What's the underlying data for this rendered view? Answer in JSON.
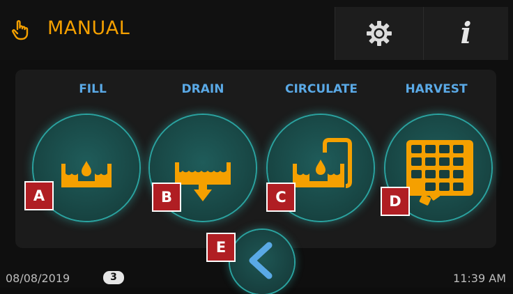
{
  "header": {
    "mode_title": "MANUAL",
    "mode_icon": "hand-pointer-icon",
    "settings_icon": "gear-icon",
    "info_icon": "info-icon",
    "info_glyph": "i"
  },
  "actions": [
    {
      "label": "FILL",
      "icon": "fill-tank-icon",
      "marker": "A"
    },
    {
      "label": "DRAIN",
      "icon": "drain-tank-icon",
      "marker": "B"
    },
    {
      "label": "CIRCULATE",
      "icon": "circulate-icon",
      "marker": "C"
    },
    {
      "label": "HARVEST",
      "icon": "harvest-icon",
      "marker": "D"
    }
  ],
  "back": {
    "icon": "chevron-left-icon",
    "marker": "E"
  },
  "footer": {
    "date": "08/08/2019",
    "badge": "3",
    "time": "11:39 AM"
  },
  "colors": {
    "accent_orange": "#f5a000",
    "label_blue": "#5aa9e6",
    "button_teal": "#2aa3a0",
    "marker_red": "#b01e23"
  }
}
